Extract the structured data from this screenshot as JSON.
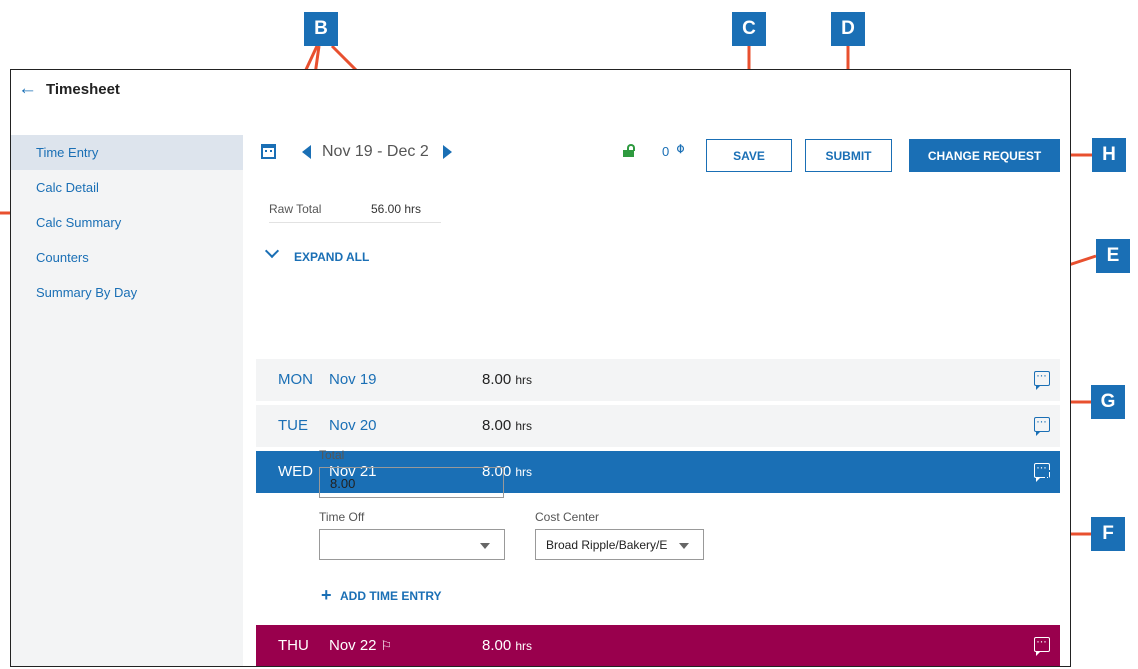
{
  "header": {
    "title": "Timesheet"
  },
  "sidebar": {
    "items": [
      {
        "label": "Time Entry"
      },
      {
        "label": "Calc Detail"
      },
      {
        "label": "Calc Summary"
      },
      {
        "label": "Counters"
      },
      {
        "label": "Summary By Day"
      }
    ]
  },
  "toolbar": {
    "date_range": "Nov 19 - Dec 2",
    "attachments_count": "0",
    "save_label": "SAVE",
    "submit_label": "SUBMIT",
    "change_request_label": "CHANGE REQUEST"
  },
  "summary": {
    "raw_total_label": "Raw Total",
    "raw_total_value": "56.00 hrs",
    "expand_all_label": "EXPAND ALL"
  },
  "days": [
    {
      "day": "MON",
      "date": "Nov 19",
      "hours": "8.00",
      "unit": "hrs"
    },
    {
      "day": "TUE",
      "date": "Nov 20",
      "hours": "8.00",
      "unit": "hrs"
    },
    {
      "day": "WED",
      "date": "Nov 21",
      "hours": "8.00",
      "unit": "hrs"
    },
    {
      "day": "THU",
      "date": "Nov 22",
      "hours": "8.00",
      "unit": "hrs"
    }
  ],
  "detail": {
    "total_label": "Total",
    "total_value": "8.00",
    "time_off_label": "Time Off",
    "time_off_value": "",
    "cost_center_label": "Cost Center",
    "cost_center_value": "Broad Ripple/Bakery/E",
    "add_time_entry_label": "ADD TIME ENTRY"
  },
  "callouts": [
    "B",
    "C",
    "D",
    "E",
    "F",
    "G",
    "H"
  ],
  "colors": {
    "accent": "#1a6fb5",
    "annotation": "#e8502f",
    "holiday": "#99004d",
    "unlocked": "#2e9a3f"
  },
  "icons": [
    "back-arrow-icon",
    "calendar-icon",
    "unlock-icon",
    "paperclip-icon",
    "comment-icon",
    "trash-icon",
    "flag-icon",
    "chevron-down-icon",
    "plus-icon"
  ]
}
